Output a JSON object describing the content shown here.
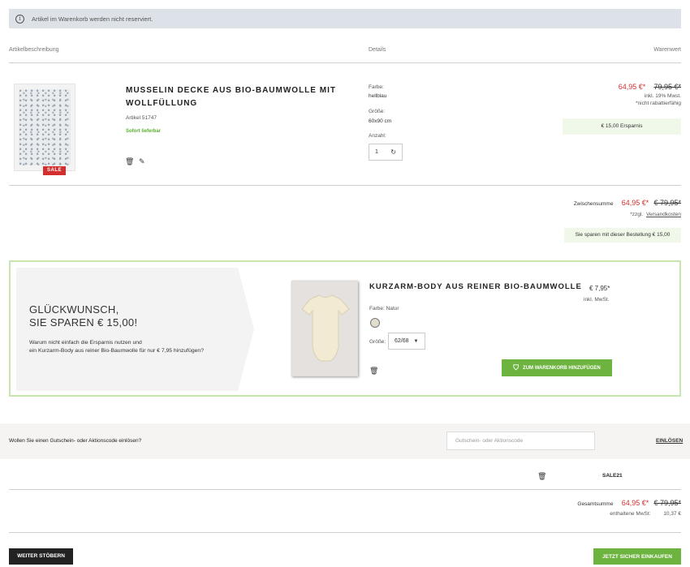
{
  "notice": {
    "icon": "info-icon",
    "text": "Artikel im Warenkorb werden nicht reserviert."
  },
  "table_headers": {
    "description": "Artikelbeschreibung",
    "details": "Details",
    "value": "Warenwert"
  },
  "item": {
    "title_line1": "MUSSELIN DECKE AUS BIO-BAUMWOLLE MIT",
    "title_line2": "WOLLFÜLLUNG",
    "article": "Artikel 51747",
    "availability": "Sofort lieferbar",
    "badge": "SALE",
    "color_label": "Farbe:",
    "color_value": "hellblau",
    "size_label": "Größe:",
    "size_value": "60x90 cm",
    "qty_label": "Anzahl:",
    "qty_value": "1",
    "price": "64,95 €*",
    "old_price": "79,95 €*",
    "vat_note": "inkl. 19% Mwst.",
    "discount_note": "*nicht rabattierfähig",
    "savings": "€ 15,00 Ersparnis"
  },
  "subtotal": {
    "label": "Zwischensumme",
    "price": "64,95 €*",
    "old_price": "€ 79,95*",
    "shipping_prefix": "*zzgl.",
    "shipping_link": "Versandkosten",
    "savings_msg": "Sie sparen mit dieser Bestellung € 15,00"
  },
  "promo": {
    "headline1": "GLÜCKWUNSCH,",
    "headline2": "SIE SPAREN € 15,00!",
    "desc1": "Warum nicht einfach die Ersparnis nutzen und",
    "desc2": "ein Kurzarm-Body aus reiner Bio-Baumwolle für nur € 7,95 hinzufügen?",
    "product_title": "KURZARM-BODY AUS REINER BIO-BAUMWOLLE",
    "price": "€ 7,95*",
    "vat": "inkl. MwSt.",
    "color_label": "Farbe: Natur",
    "size_label": "Größe:",
    "size_value": "62/68",
    "add_button": "ZUM WARENKORB HINZUFÜGEN"
  },
  "voucher": {
    "question": "Wollen Sie einen Gutschein- oder Aktionscode einlösen?",
    "placeholder": "Gutschein- oder Aktionscode",
    "redeem": "EINLÖSEN",
    "applied_code": "SALE21"
  },
  "total": {
    "label": "Gesamtsumme",
    "price": "64,95 €*",
    "old_price": "€ 79,95*",
    "vat_label": "enthaltene MwSt:",
    "vat_value": "10,37 €"
  },
  "actions": {
    "continue": "WEITER STÖBERN",
    "checkout": "JETZT SICHER EINKAUFEN"
  },
  "colors": {
    "sale_red": "#d32f2f",
    "accent_green": "#6db33f",
    "promo_border": "#c6e6ad",
    "notice_bg": "#dde2e8"
  }
}
